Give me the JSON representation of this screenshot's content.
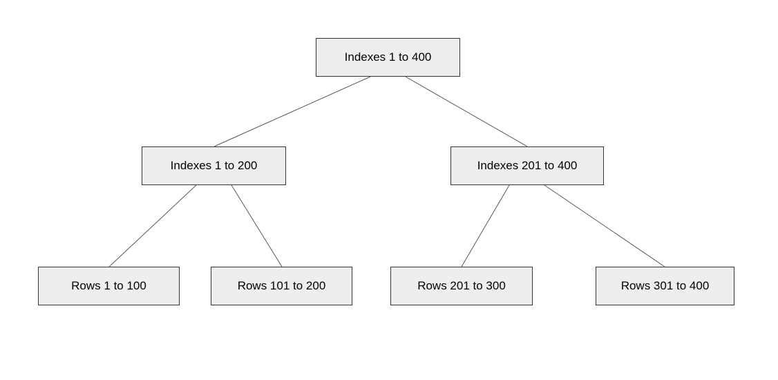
{
  "tree": {
    "root": {
      "label": "Indexes 1 to 400"
    },
    "level1": {
      "left": {
        "label": "Indexes 1 to 200"
      },
      "right": {
        "label": "Indexes 201 to 400"
      }
    },
    "level2": {
      "leaf0": {
        "label": "Rows 1 to 100"
      },
      "leaf1": {
        "label": "Rows 101 to 200"
      },
      "leaf2": {
        "label": "Rows 201 to 300"
      },
      "leaf3": {
        "label": "Rows 301 to 400"
      }
    }
  }
}
